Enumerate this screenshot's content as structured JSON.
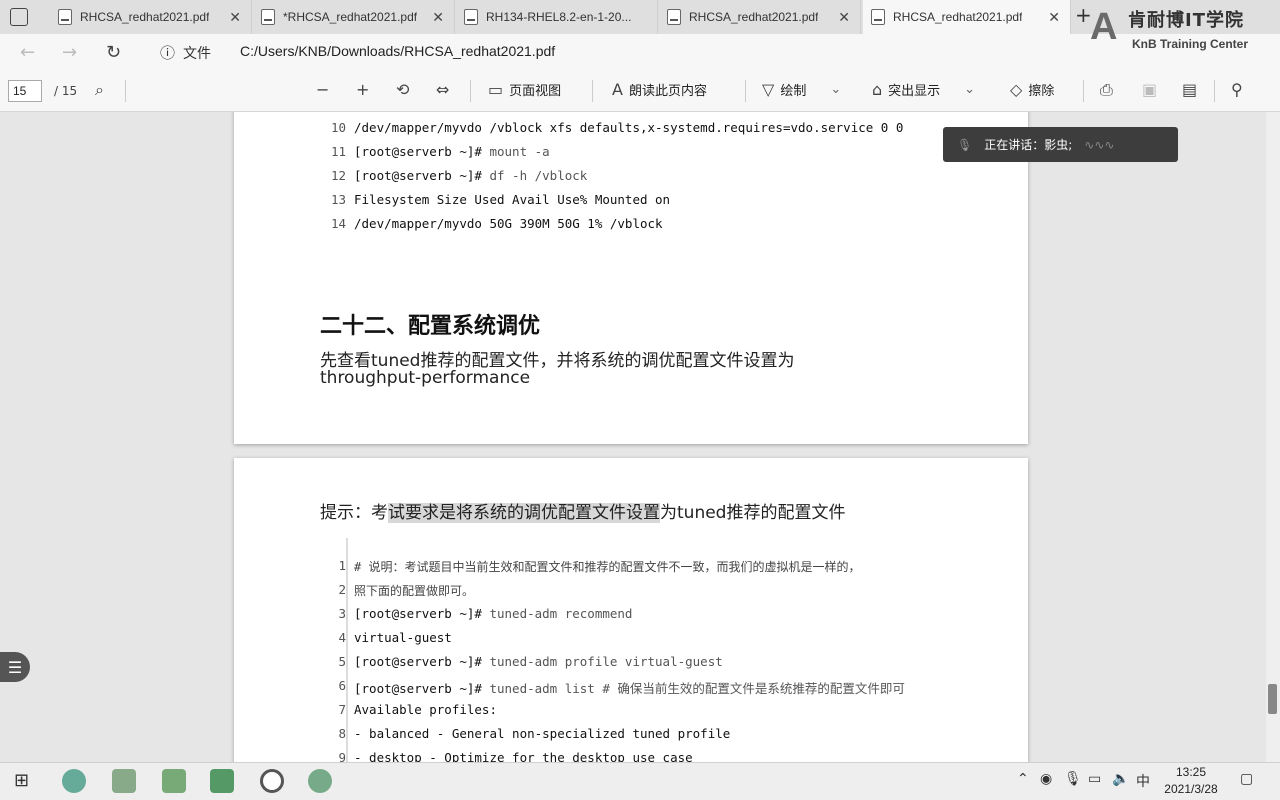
{
  "tabs": [
    {
      "title": "RHCSA_redhat2021.pdf",
      "active": false
    },
    {
      "title": "*RHCSA_redhat2021.pdf",
      "active": false
    },
    {
      "title": "RH134-RHEL8.2-en-1-20...",
      "active": false
    },
    {
      "title": "RHCSA_redhat2021.pdf",
      "active": false
    },
    {
      "title": "RHCSA_redhat2021.pdf",
      "active": true
    }
  ],
  "logo": {
    "cn": "肯耐博IT学院",
    "en": "KnB Training Center"
  },
  "address": {
    "file_label": "文件",
    "url": "C:/Users/KNB/Downloads/RHCSA_redhat2021.pdf"
  },
  "toolbar": {
    "page": "15",
    "total": "/ 15",
    "page_view": "页面视图",
    "read_aloud": "朗读此页内容",
    "draw": "绘制",
    "highlight": "突出显示",
    "erase": "擦除"
  },
  "page1": {
    "lines": [
      {
        "n": "10",
        "text": "/dev/mapper/myvdo /vblock xfs defaults,x-systemd.requires=vdo.service 0 0"
      },
      {
        "n": "11",
        "prompt": "[root@serverb ~]# ",
        "cmd": "mount -a"
      },
      {
        "n": "12",
        "prompt": "[root@serverb ~]# ",
        "cmd": "df -h /vblock"
      },
      {
        "n": "13",
        "text": "Filesystem Size Used Avail Use% Mounted on"
      },
      {
        "n": "14",
        "text": "/dev/mapper/myvdo 50G 390M 50G 1% /vblock"
      }
    ],
    "heading": "二十二、配置系统调优",
    "desc_line1": "先查看tuned推荐的配置文件，并将系统的调优配置文件设置为",
    "desc_line2": "throughput-performance"
  },
  "page2": {
    "hint_a": "提示：考",
    "hint_b": "试要求是将系统的调优配置文件设置",
    "hint_c": "为tuned推荐的配置文件",
    "lines": [
      {
        "n": "1",
        "text": "# 说明：考试题目中当前生效和配置文件和推荐的配置文件不一致，而我们的虚拟机是一样的，"
      },
      {
        "n": "2",
        "text": "照下面的配置做即可。"
      },
      {
        "n": "3",
        "prompt": "[root@serverb ~]# ",
        "cmd": "tuned-adm recommend"
      },
      {
        "n": "4",
        "text": "virtual-guest"
      },
      {
        "n": "5",
        "prompt": "[root@serverb ~]# ",
        "cmd": "tuned-adm profile virtual-guest"
      },
      {
        "n": "6",
        "prompt": "[root@serverb ~]# ",
        "cmd": "tuned-adm list # 确保当前生效的配置文件是系统推荐的配置文件即可"
      },
      {
        "n": "7",
        "text": "Available profiles:"
      },
      {
        "n": "8",
        "text": "- balanced - General non-specialized tuned profile"
      },
      {
        "n": "9",
        "text": "- desktop - Optimize for the desktop use case"
      }
    ]
  },
  "speaker": {
    "label": "正在讲话：影虫;"
  },
  "taskbar": {
    "ime": "中",
    "time": "13:25",
    "date": "2021/3/28"
  }
}
